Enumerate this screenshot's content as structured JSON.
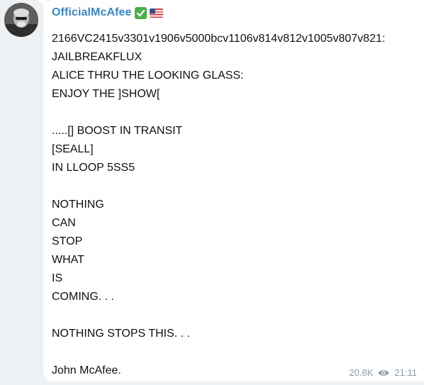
{
  "post": {
    "sender": "OfficialMcAfee",
    "verified_icon": "check-mark-icon",
    "flag_icon": "us-flag-icon",
    "text": "2166VC2415v3301v1906v5000bcv1106v814v812v1005v807v821:\nJAILBREAKFLUX\nALICE THRU THE LOOKING GLASS:\nENJOY THE ]SHOW[\n\n.....[] BOOST IN TRANSIT\n[SEALL]\nIN LLOOP 5SS5\n\nNOTHING\nCAN\nSTOP\nWHAT\nIS\nCOMING. . .\n\nNOTHING STOPS THIS. . .\n\nJohn McAfee.",
    "views": "20.8K",
    "views_icon": "eye-icon",
    "time": "21:11"
  },
  "colors": {
    "sender": "#3a87c6",
    "background": "#eef1f4",
    "bubble": "#ffffff",
    "meta": "#8a9ba8"
  }
}
